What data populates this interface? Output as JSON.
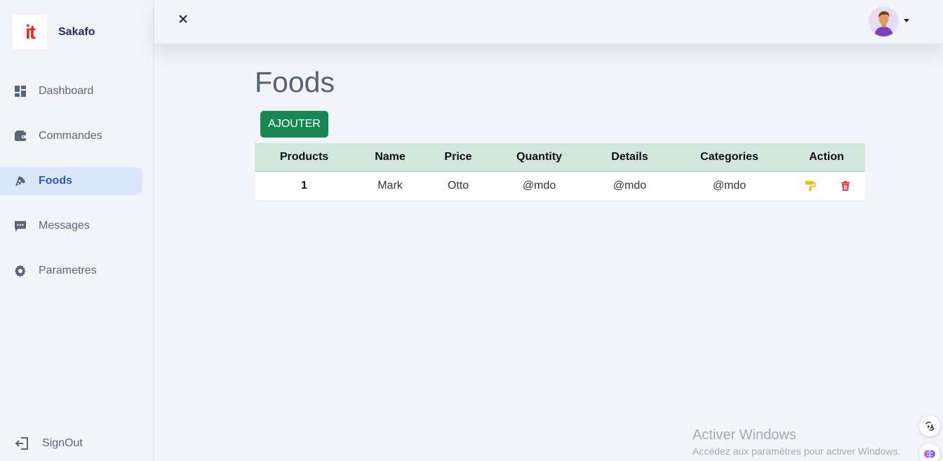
{
  "brand": {
    "logo_text": "it",
    "name": "Sakafo"
  },
  "sidebar": {
    "items": [
      {
        "label": "Dashboard",
        "icon": "dashboard-icon",
        "active": false
      },
      {
        "label": "Commandes",
        "icon": "wallet-icon",
        "active": false
      },
      {
        "label": "Foods",
        "icon": "pizza-icon",
        "active": true
      },
      {
        "label": "Messages",
        "icon": "message-icon",
        "active": false
      },
      {
        "label": "Parametres",
        "icon": "gear-icon",
        "active": false
      }
    ],
    "signout_label": "SignOut"
  },
  "topbar": {
    "close_icon": "close-icon",
    "avatar": "user-avatar"
  },
  "main": {
    "title": "Foods",
    "add_button_label": "AJOUTER",
    "table": {
      "headers": [
        "Products",
        "Name",
        "Price",
        "Quantity",
        "Details",
        "Categories",
        "Action"
      ],
      "rows": [
        {
          "product": "1",
          "name": "Mark",
          "price": "Otto",
          "quantity": "@mdo",
          "details": "@mdo",
          "categories": "@mdo"
        }
      ]
    }
  },
  "watermark": {
    "title": "Activer Windows",
    "subtitle": "Accédez aux paramètres pour activer Windows."
  },
  "colors": {
    "accent_green": "#198754",
    "active_nav_bg": "#dbe7fb",
    "active_nav_text": "#2858cf",
    "edit_icon": "#f5b800",
    "delete_icon": "#dc3545"
  }
}
